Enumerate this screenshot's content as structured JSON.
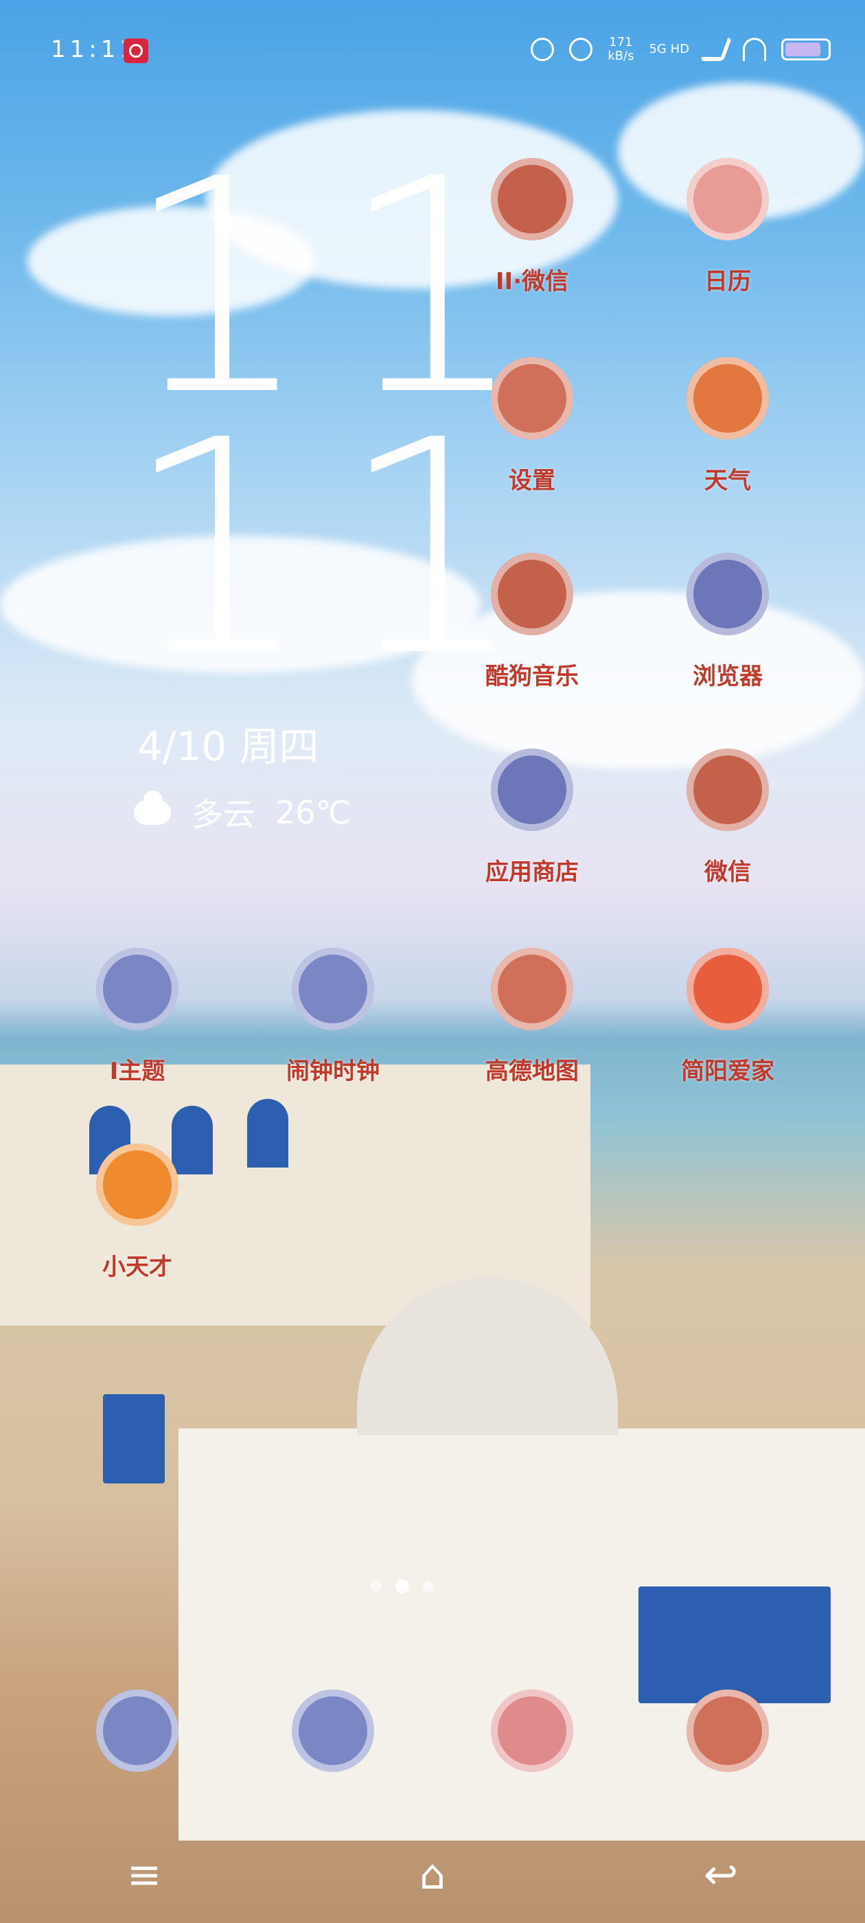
{
  "status_bar": {
    "time": "11:11",
    "speed_top": "171",
    "speed_bottom": "kB/s",
    "network": "5G HD",
    "battery_level": 0.85,
    "icons": [
      "alarm-icon",
      "mute-icon",
      "signal-icon",
      "wifi-icon",
      "battery-icon"
    ]
  },
  "clock": {
    "hours": "11",
    "minutes": "11"
  },
  "date": "4/10 周四",
  "weather": {
    "condition": "多云",
    "temperature": "26℃",
    "icon": "cloud-icon"
  },
  "apps": [
    {
      "label": "II·微信",
      "icon": "wechat-clone-icon",
      "color": "#c4614a"
    },
    {
      "label": "日历",
      "icon": "calendar-icon",
      "color": "#e89c95"
    },
    {
      "label": "设置",
      "icon": "settings-icon",
      "color": "#d0705a"
    },
    {
      "label": "天气",
      "icon": "weather-sun-icon",
      "color": "#e2783f"
    },
    {
      "label": "酷狗音乐",
      "icon": "kugou-music-icon",
      "color": "#c4614a"
    },
    {
      "label": "浏览器",
      "icon": "browser-icon",
      "color": "#6c76b8"
    },
    {
      "label": "应用商店",
      "icon": "app-store-icon",
      "color": "#6c76b8"
    },
    {
      "label": "微信",
      "icon": "wechat-icon",
      "color": "#c4614a"
    },
    {
      "label": "I主题",
      "icon": "theme-icon",
      "color": "#7b86c4"
    },
    {
      "label": "闹钟时钟",
      "icon": "alarm-clock-icon",
      "color": "#7b86c4"
    },
    {
      "label": "高德地图",
      "icon": "amap-icon",
      "color": "#d0705a"
    },
    {
      "label": "简阳爱家",
      "icon": "home-love-icon",
      "color": "#e85d3b"
    },
    {
      "label": "小天才",
      "icon": "xiaotiancai-icon",
      "color": "#f08a2e"
    }
  ],
  "dock": [
    {
      "icon": "phone-icon"
    },
    {
      "icon": "grapes-icon"
    },
    {
      "icon": "camera-icon"
    },
    {
      "icon": "gallery-icon"
    }
  ],
  "page_dots": 3,
  "active_page": 1,
  "navbar": {
    "menu": "≡",
    "home": "⌂",
    "back": "↩"
  }
}
